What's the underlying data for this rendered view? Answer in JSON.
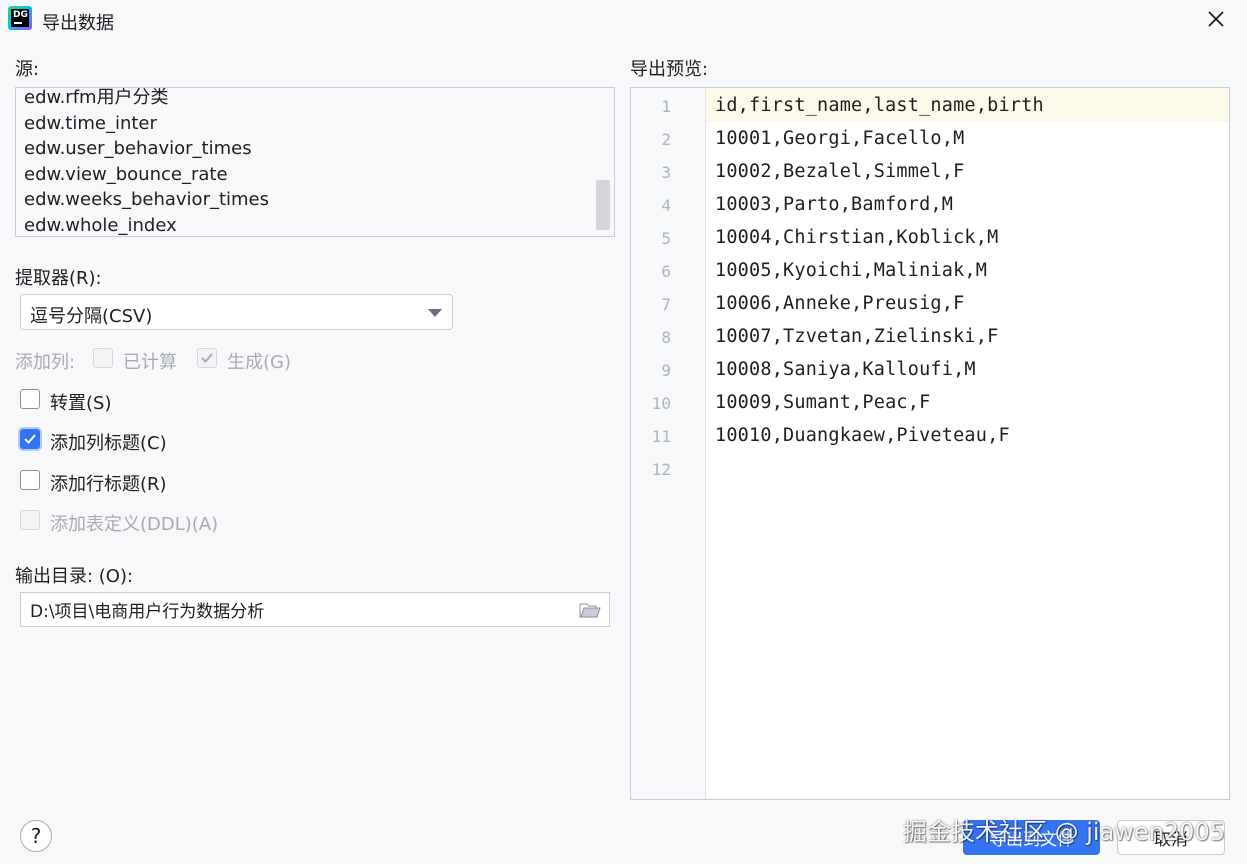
{
  "window": {
    "title": "导出数据",
    "app_icon_text": "DG"
  },
  "source": {
    "label": "源:",
    "items": [
      "edw.rfm用户分类",
      "edw.time_inter",
      "edw.user_behavior_times",
      "edw.view_bounce_rate",
      "edw.weeks_behavior_times",
      "edw.whole_index"
    ]
  },
  "extractor": {
    "label": "提取器(R):",
    "selected": "逗号分隔(CSV)"
  },
  "add_columns": {
    "label": "添加列:",
    "computed_label": "已计算",
    "computed_checked": false,
    "generated_label": "生成(G)",
    "generated_checked": true
  },
  "options": {
    "transpose_label": "转置(S)",
    "transpose_checked": false,
    "col_headers_label": "添加列标题(C)",
    "col_headers_checked": true,
    "row_headers_label": "添加行标题(R)",
    "row_headers_checked": false,
    "ddl_label": "添加表定义(DDL)(A)",
    "ddl_checked": false
  },
  "output_dir": {
    "label": "输出目录: (O):",
    "value": "D:\\项目\\电商用户行为数据分析"
  },
  "preview": {
    "label": "导出预览:",
    "line_numbers": [
      "1",
      "2",
      "3",
      "4",
      "5",
      "6",
      "7",
      "8",
      "9",
      "10",
      "11",
      "12"
    ],
    "lines": [
      "id,first_name,last_name,birth",
      "10001,Georgi,Facello,M",
      "10002,Bezalel,Simmel,F",
      "10003,Parto,Bamford,M",
      "10004,Chirstian,Koblick,M",
      "10005,Kyoichi,Maliniak,M",
      "10006,Anneke,Preusig,F",
      "10007,Tzvetan,Zielinski,F",
      "10008,Saniya,Kalloufi,M",
      "10009,Sumant,Peac,F",
      "10010,Duangkaew,Piveteau,F",
      ""
    ]
  },
  "buttons": {
    "help": "?",
    "export": "导出到文件",
    "cancel": "取消"
  },
  "watermark": "掘金技术社区 @ jiawen2005",
  "colors": {
    "accent": "#3574f0",
    "background": "#f7f8fa",
    "current_line": "#fdf9e8"
  }
}
